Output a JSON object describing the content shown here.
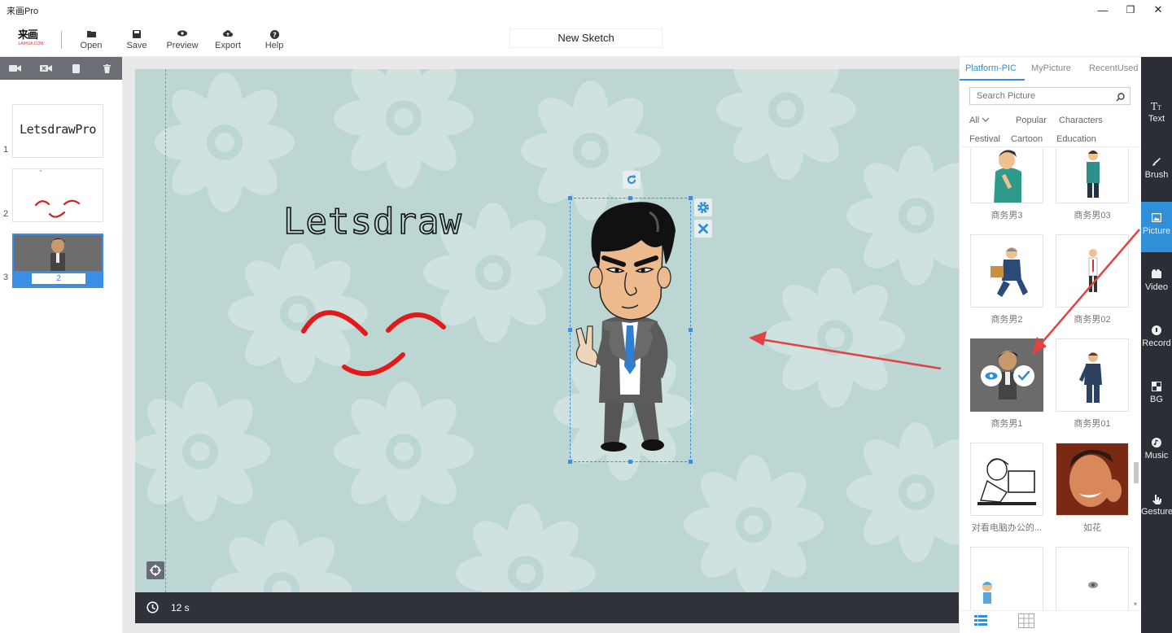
{
  "window": {
    "title": "来画Pro",
    "minimize": "—",
    "maximize": "❐",
    "close": "✕"
  },
  "toolbar": {
    "logo_main": "来画",
    "logo_sub": "LAIHUA.COM",
    "open": "Open",
    "save": "Save",
    "preview": "Preview",
    "export": "Export",
    "help": "Help",
    "sketch_title": "New Sketch"
  },
  "slides": [
    {
      "number": "1",
      "text": "LetsdrawPro"
    },
    {
      "number": "2"
    },
    {
      "number": "3",
      "duration": "2"
    }
  ],
  "canvas": {
    "text": "Letsdraw",
    "timer": "12 s",
    "background": "#bcd6d3"
  },
  "library": {
    "tabs": [
      "Platform-PIC",
      "MyPicture",
      "RecentUsed"
    ],
    "active_tab": "Platform-PIC",
    "search_placeholder": "Search Picture",
    "categories_row1": [
      "All",
      "Popular",
      "Characters"
    ],
    "categories_row2": [
      "Festival",
      "Cartoon",
      "Education"
    ],
    "items": [
      {
        "label": "商务男3"
      },
      {
        "label": "商务男03"
      },
      {
        "label": "商务男2"
      },
      {
        "label": "商务男02"
      },
      {
        "label": "商务男1"
      },
      {
        "label": "商务男01"
      },
      {
        "label": "对看电脑办公的..."
      },
      {
        "label": "如花"
      }
    ]
  },
  "rail": [
    {
      "label": "Text",
      "icon": "text-icon"
    },
    {
      "label": "Brush",
      "icon": "brush-icon"
    },
    {
      "label": "Picture",
      "icon": "picture-icon",
      "active": true
    },
    {
      "label": "Video",
      "icon": "video-icon"
    },
    {
      "label": "Record",
      "icon": "record-icon"
    },
    {
      "label": "BG",
      "icon": "bg-icon"
    },
    {
      "label": "Music",
      "icon": "music-icon"
    },
    {
      "label": "Gesture",
      "icon": "gesture-icon"
    }
  ],
  "colors": {
    "accent": "#2f8fd8",
    "rail_bg": "#2b2e34",
    "annotation_red": "#e04343"
  }
}
